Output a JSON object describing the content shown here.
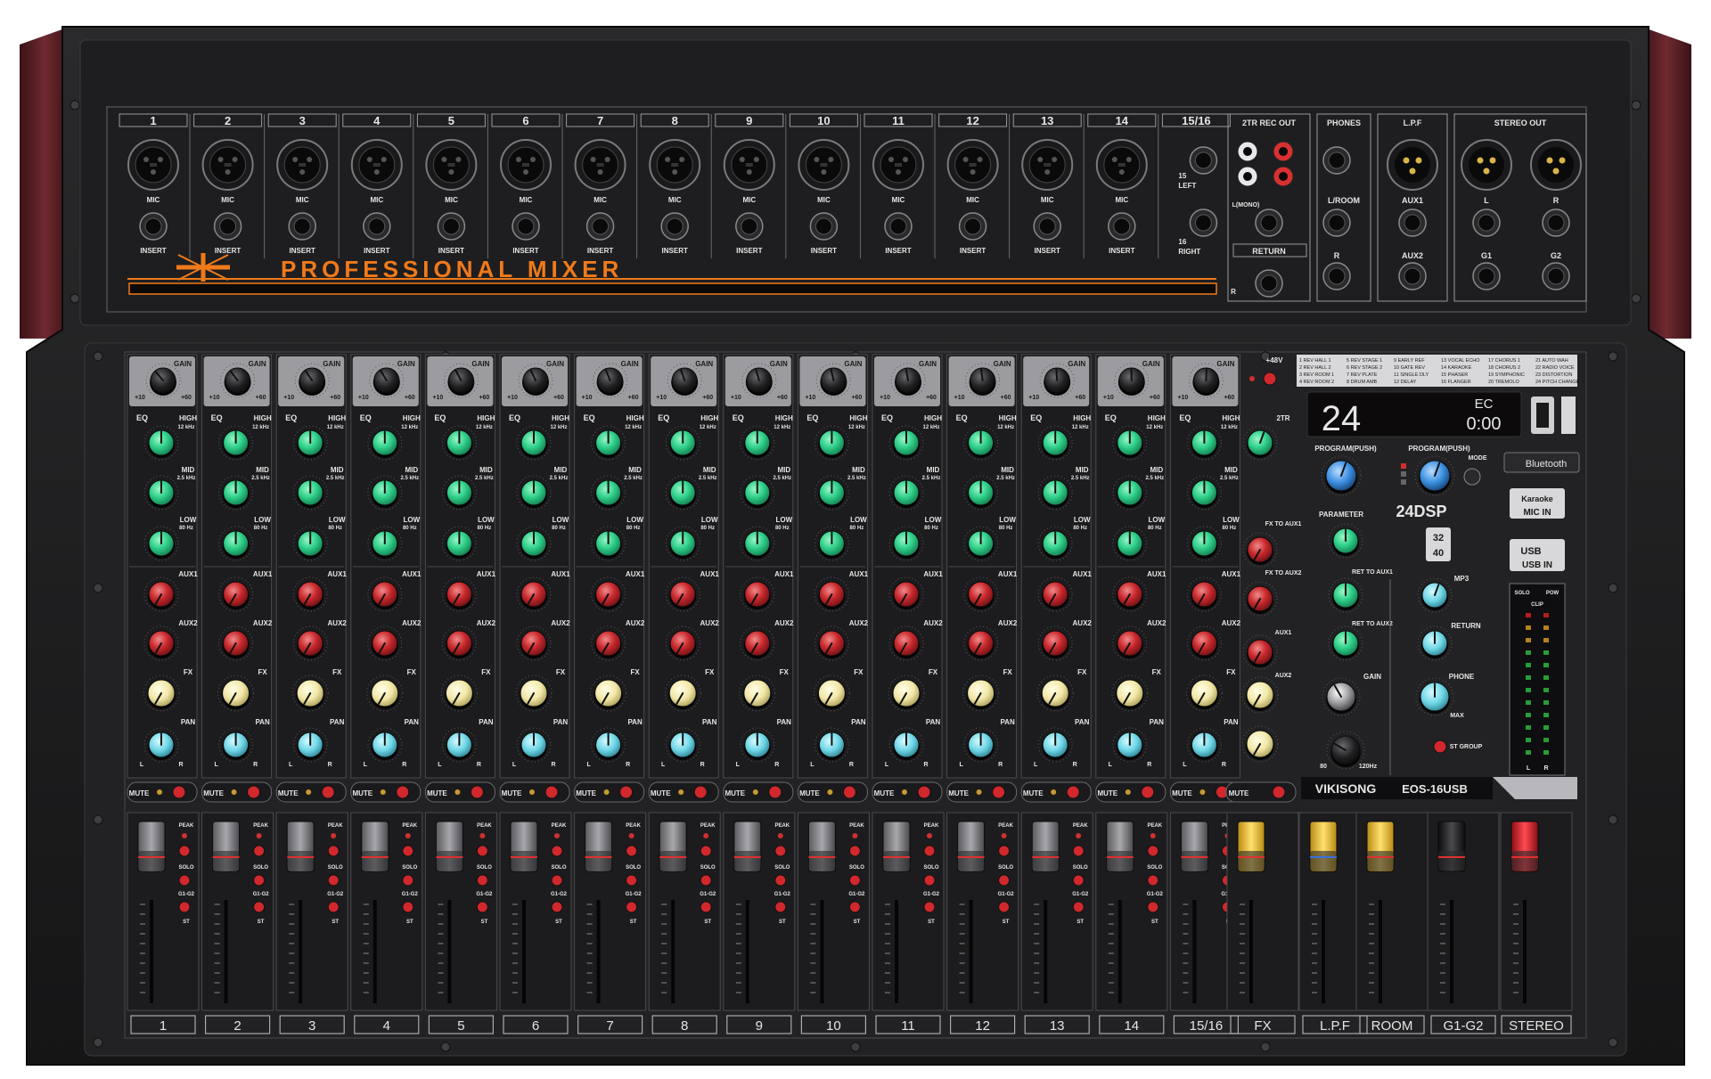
{
  "brand": {
    "top_title": "PROFESSIONAL MIXER",
    "maker": "VIKISONG",
    "model": "EOS-16USB",
    "dsp_badge": "24DSP",
    "bit_badge": "32/40"
  },
  "channels": [
    "1",
    "2",
    "3",
    "4",
    "5",
    "6",
    "7",
    "8",
    "9",
    "10",
    "11",
    "12",
    "13",
    "14",
    "15/16"
  ],
  "bottom_labels": [
    "1",
    "2",
    "3",
    "4",
    "5",
    "6",
    "7",
    "8",
    "9",
    "10",
    "11",
    "12",
    "13",
    "14",
    "15/16",
    "FX",
    "L.P.F",
    "ROOM",
    "G1-G2",
    "STEREO"
  ],
  "jack_labels": {
    "mic": "MIC",
    "insert": "INSERT",
    "left15": "15 LEFT",
    "right16": "16 RIGHT"
  },
  "rear_sections": {
    "rec_out": "2TR REC OUT",
    "mono": "L(MONO)",
    "return": "RETURN",
    "phones": "PHONES",
    "l_room": "L/ROOM",
    "lpf": "L.P.F",
    "aux1": "AUX1",
    "aux2": "AUX2",
    "stereo_out": "STEREO OUT",
    "g1": "G1",
    "g2": "G2",
    "l": "L",
    "r": "R"
  },
  "strip_labels": {
    "gain": "GAIN",
    "eq": "EQ",
    "high": "HIGH",
    "high_freq": "12 kHz",
    "mid": "MID",
    "mid_freq": "2.5 kHz",
    "low": "LOW",
    "low_freq": "80 Hz",
    "aux1": "AUX1",
    "aux2": "AUX2",
    "fx": "FX",
    "pan": "PAN",
    "mute": "MUTE",
    "peak": "PEAK",
    "solo": "SOLO",
    "g1g2": "G1-G2",
    "st": "ST"
  },
  "master_section": {
    "phantom": "+48V",
    "two_tr": "2TR",
    "fx_to_aux1": "FX TO AUX1",
    "fx_to_aux2": "FX TO AUX2",
    "fx_aux1": "AUX1",
    "fx_aux2": "AUX2",
    "program_push": "PROGRAM(PUSH)",
    "program_push2": "PROGRAM(PUSH)",
    "mode": "MODE",
    "parameter": "PARAMETER",
    "ret_to_aux1": "RET TO AUX1",
    "ret_to_aux2": "RET TO AUX2",
    "gain": "GAIN",
    "mp3": "MP3",
    "return": "RETURN",
    "phone": "PHONE",
    "max": "MAX",
    "st_group": "ST GROUP",
    "freq_low": "80",
    "freq_high": "120Hz",
    "bluetooth": "Bluetooth",
    "karaoke": "Karaoke",
    "mic_in": "MIC IN",
    "usb_in": "USB IN",
    "solo": "SOLO",
    "pow": "POW",
    "clip": "CLIP"
  },
  "display": {
    "program_number": "24",
    "player_readout": "0:00",
    "player_mode": "EC"
  },
  "effects_table": [
    "1 REV HALL 1",
    "2 REV HALL 2",
    "3 REV ROOM 1",
    "4 REV ROOM 2",
    "5 REV STAGE 1",
    "6 REV STAGE 2",
    "7 REV PLATE",
    "8 DRUM AMB",
    "9 EARLY REF",
    "10 GATE REV",
    "11 SINGLE DLY",
    "12 DELAY",
    "13 VOCAL ECHO",
    "14 KARAOKE",
    "15 PHASER",
    "16 FLANGER",
    "17 CHORUS 1",
    "18 CHORUS 2",
    "19 SYMPHONIC",
    "20 TREMOLO",
    "21 AUTO WAH",
    "22 RADIO VOICE",
    "23 DISTORTION",
    "24 PITCH CHANGE"
  ],
  "colors": {
    "chassis": "#1c1c1e",
    "panel": "#242426",
    "wood": "#5a1f24",
    "accent_orange": "#f07a1a",
    "knob_green": "#2fd08a",
    "knob_red": "#c8282c",
    "knob_cream": "#f2e7a8",
    "knob_cyan": "#6fd6e6",
    "knob_blue": "#3b8fe0",
    "fader_yellow": "#f2c640",
    "fader_red": "#d21f2a",
    "display_amber": "#ff7a1a"
  }
}
